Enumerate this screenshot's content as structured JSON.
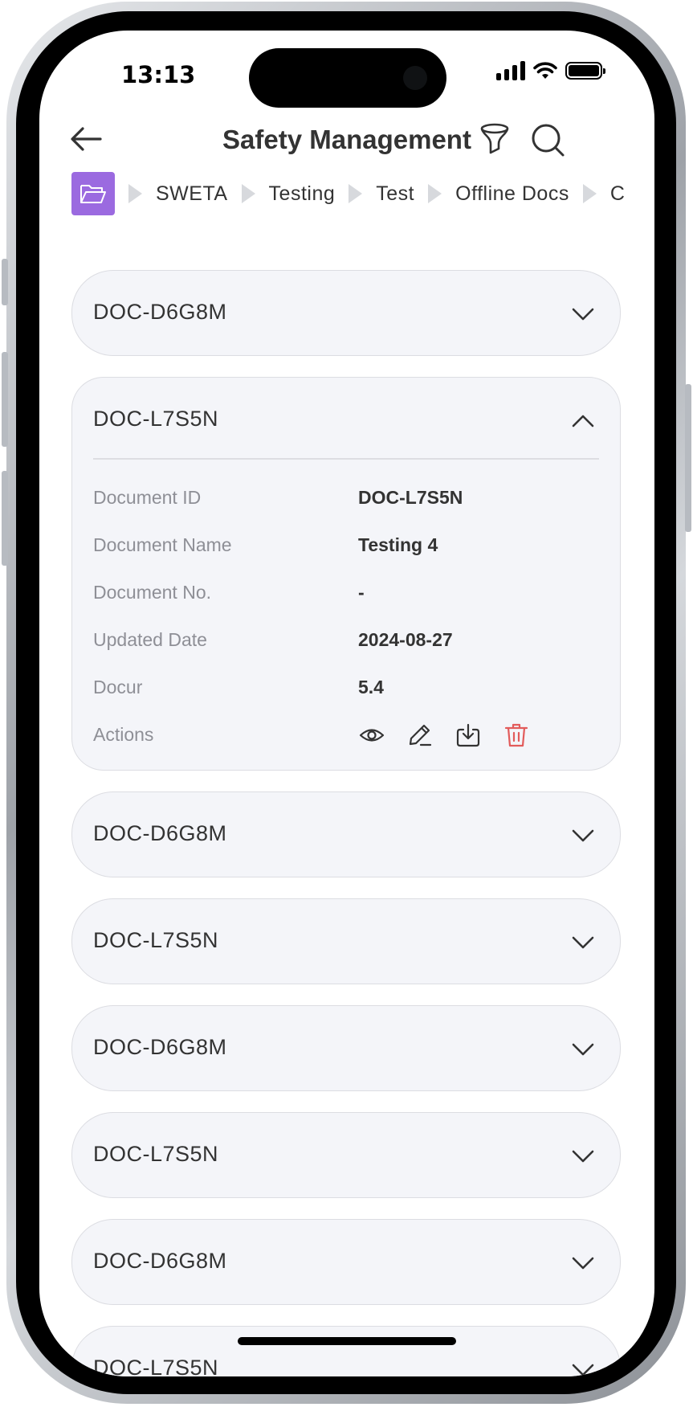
{
  "status": {
    "time": "13:13"
  },
  "header": {
    "title": "Safety Management"
  },
  "breadcrumb": {
    "items": [
      "SWETA",
      "Testing",
      "Test",
      "Offline Docs",
      "C"
    ]
  },
  "colors": {
    "accent": "#9b6ae0",
    "danger": "#e25b5b",
    "text": "#333333",
    "muted": "#8e8f96",
    "card": "#f4f5f9"
  },
  "documents": [
    {
      "id": "DOC-D6G8M",
      "expanded": false
    },
    {
      "id": "DOC-L7S5N",
      "expanded": true,
      "details": {
        "doc_id_label": "Document ID",
        "doc_id": "DOC-L7S5N",
        "name_label": "Document Name",
        "name": "Testing 4",
        "no_label": "Document No.",
        "no": "-",
        "date_label": "Updated Date",
        "date": "2024-08-27",
        "ver_label": "Docur",
        "ver": "5.4",
        "actions_label": "Actions"
      }
    },
    {
      "id": "DOC-D6G8M",
      "expanded": false
    },
    {
      "id": "DOC-L7S5N",
      "expanded": false
    },
    {
      "id": "DOC-D6G8M",
      "expanded": false
    },
    {
      "id": "DOC-L7S5N",
      "expanded": false
    },
    {
      "id": "DOC-D6G8M",
      "expanded": false
    },
    {
      "id": "DOC-L7S5N",
      "expanded": false
    }
  ],
  "icons": [
    "back-arrow-icon",
    "filter-icon",
    "search-icon",
    "folder-icon",
    "chevron-down-icon",
    "chevron-up-icon",
    "eye-icon",
    "edit-icon",
    "download-icon",
    "trash-icon"
  ]
}
